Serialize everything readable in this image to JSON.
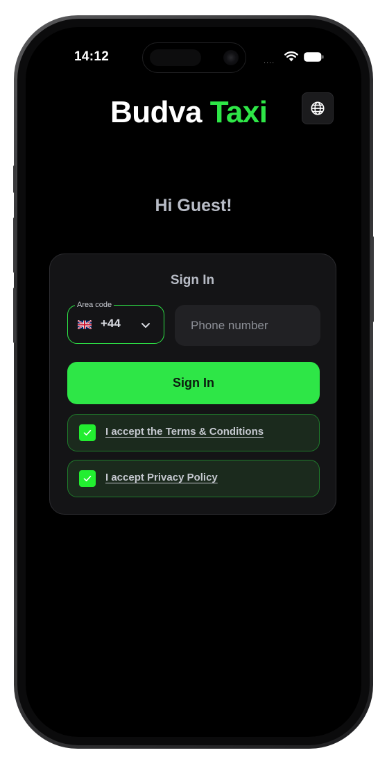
{
  "status_bar": {
    "time": "14:12",
    "signal_text": "...."
  },
  "header": {
    "brand_primary": "Budva",
    "brand_accent": "Taxi",
    "language_button_icon": "globe-icon"
  },
  "greeting": "Hi Guest!",
  "signin_card": {
    "title": "Sign In",
    "area_code": {
      "label": "Area code",
      "value": "+44",
      "flag_icon": "uk-flag-icon"
    },
    "phone": {
      "placeholder": "Phone number",
      "value": ""
    },
    "submit_label": "Sign In",
    "consents": [
      {
        "label": "I accept the Terms & Conditions",
        "checked": true
      },
      {
        "label": "I accept Privacy Policy",
        "checked": true
      }
    ]
  },
  "colors": {
    "accent": "#2ee647",
    "background": "#000000",
    "card": "#141416",
    "consent_bg": "#1b2a1d"
  }
}
